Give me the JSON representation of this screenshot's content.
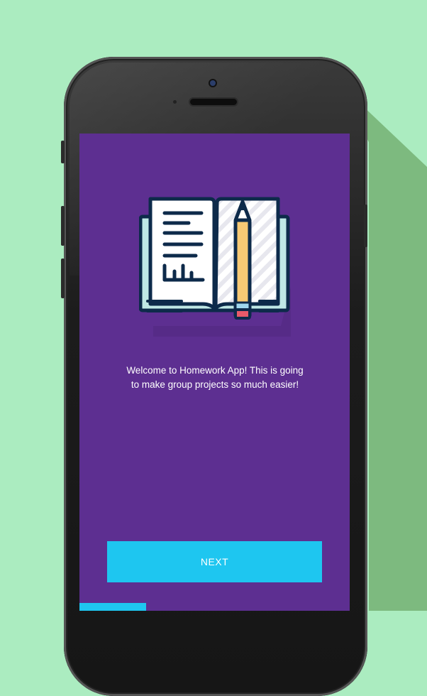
{
  "colors": {
    "background": "#abecc0",
    "shadow": "#7dba7f",
    "screen": "#5d2f91",
    "accent": "#1ec6f0",
    "text": "#ffffff"
  },
  "illustration": {
    "icon": "open-book-with-pencil-icon"
  },
  "onboarding": {
    "message": "Welcome to Homework App! This is going to make group projects so much easier!",
    "next_label": "NEXT"
  }
}
